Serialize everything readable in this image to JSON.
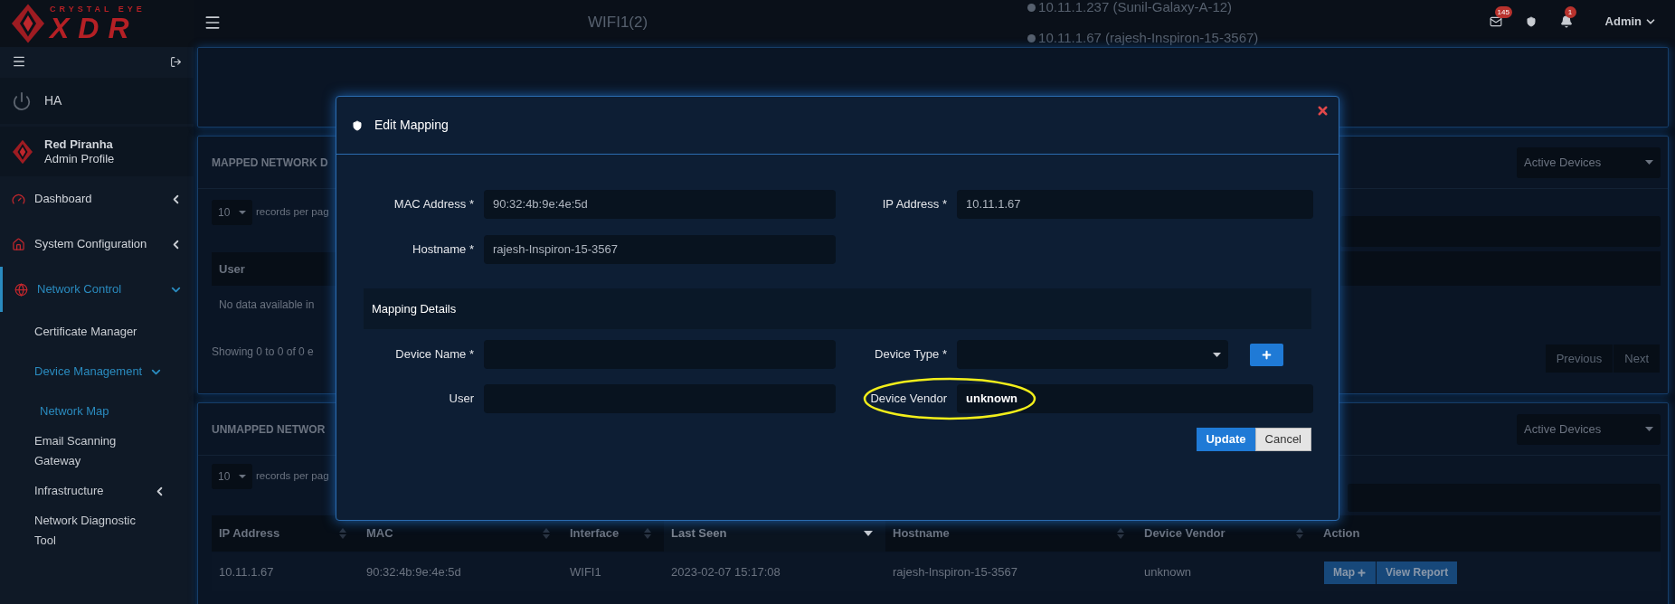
{
  "header": {
    "logo": {
      "tagline": "CRYSTAL EYE",
      "name": "XDR"
    },
    "wifi_label": "WIFI1(2)",
    "hosts": [
      "10.11.1.237 (Sunil-Galaxy-A-12)",
      "10.11.1.67 (rajesh-Inspiron-15-3567)"
    ],
    "mail_count": "145",
    "alert_count": "1",
    "user": "Admin"
  },
  "sidebar": {
    "ha_label": "HA",
    "profile": {
      "name": "Red Piranha",
      "role": "Admin Profile"
    },
    "menu": [
      {
        "label": "Dashboard",
        "selected": false,
        "expanded": false
      },
      {
        "label": "System Configuration",
        "selected": false,
        "expanded": false
      },
      {
        "label": "Network Control",
        "selected": true,
        "expanded": true,
        "children": [
          {
            "label": "Certificate Manager",
            "selected": false
          },
          {
            "label": "Device Management",
            "selected": true,
            "expanded": true,
            "children": [
              {
                "label": "Network Map",
                "selected": true
              }
            ]
          },
          {
            "label": "Email Scanning Gateway",
            "selected": false
          },
          {
            "label": "Infrastructure",
            "selected": false,
            "expanded": false
          },
          {
            "label": "Network Diagnostic Tool",
            "selected": false
          }
        ]
      }
    ]
  },
  "mapped_panel": {
    "title": "MAPPED NETWORK D",
    "filter": "Active Devices",
    "page_length": "10",
    "length_label": "records per pag",
    "columns": [
      "User"
    ],
    "empty_text": "No data available in",
    "info": "Showing 0 to 0 of 0 e",
    "pagination": [
      {
        "label": "Previous",
        "disabled": true
      },
      {
        "label": "Next",
        "disabled": true
      }
    ]
  },
  "unmapped_panel": {
    "title": "UNMAPPED NETWOR",
    "filter": "Active Devices",
    "page_length": "10",
    "length_label": "records per pag",
    "columns": [
      {
        "label": "IP Address",
        "sortable": true,
        "sorted": false
      },
      {
        "label": "MAC",
        "sortable": true,
        "sorted": false
      },
      {
        "label": "Interface",
        "sortable": true,
        "sorted": false
      },
      {
        "label": "Last Seen",
        "sortable": true,
        "sorted": true
      },
      {
        "label": "Hostname",
        "sortable": true,
        "sorted": false
      },
      {
        "label": "Device Vendor",
        "sortable": true,
        "sorted": false
      },
      {
        "label": "Action",
        "sortable": false,
        "sorted": false
      }
    ],
    "rows": [
      {
        "cells": [
          "10.11.1.67",
          "90:32:4b:9e:4e:5d",
          "WIFI1",
          "2023-02-07 15:17:08",
          "rajesh-Inspiron-15-3567",
          "unknown"
        ],
        "actions": [
          {
            "label": "Map",
            "kind": "map"
          },
          {
            "label": "View Report",
            "kind": "report"
          }
        ]
      }
    ]
  },
  "modal": {
    "title": "Edit Mapping",
    "fields": [
      {
        "label": "MAC Address *",
        "value": "90:32:4b:9e:4e:5d"
      },
      {
        "label": "IP Address *",
        "value": "10.11.1.67"
      },
      {
        "label": "Hostname *",
        "value": "rajesh-Inspiron-15-3567"
      }
    ],
    "section_title": "Mapping Details",
    "details": [
      {
        "label": "Device Name *",
        "kind": "text",
        "highlighted": false
      },
      {
        "label": "Device Type *",
        "kind": "select",
        "highlighted": false
      },
      {
        "label": "User",
        "kind": "text",
        "highlighted": false
      },
      {
        "label": "Device Vendor",
        "kind": "text",
        "value": "unknown",
        "highlighted": true
      }
    ],
    "buttons": [
      {
        "label": "Update",
        "kind": "primary"
      },
      {
        "label": "Cancel",
        "kind": "secondary"
      }
    ]
  }
}
